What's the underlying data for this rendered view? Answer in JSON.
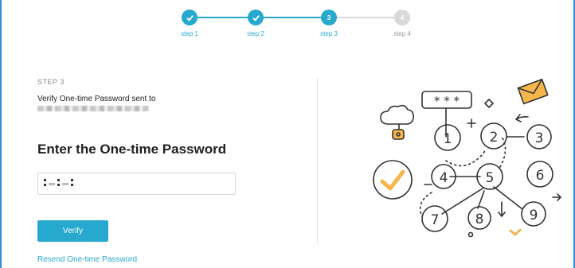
{
  "stepper": {
    "steps": [
      {
        "label": "step 1",
        "state": "done",
        "number": ""
      },
      {
        "label": "step 2",
        "state": "done",
        "number": ""
      },
      {
        "label": "step 3",
        "state": "active",
        "number": "3"
      },
      {
        "label": "step 4",
        "state": "todo",
        "number": "4"
      }
    ],
    "colors": {
      "accent": "#27a9cf",
      "inactive": "#d9d9d9"
    }
  },
  "main": {
    "kicker": "STEP 3",
    "verify_text": "Verify One-time Password sent to",
    "heading": "Enter the One-time Password",
    "verify_label": "Verify",
    "resend_label": "Resend One-time Password"
  },
  "illustration": {
    "icon": "password-keypad-illustration",
    "password_mask": "* * *",
    "numbers": [
      "1",
      "2",
      "3",
      "4",
      "5",
      "6",
      "7",
      "8",
      "9"
    ]
  }
}
